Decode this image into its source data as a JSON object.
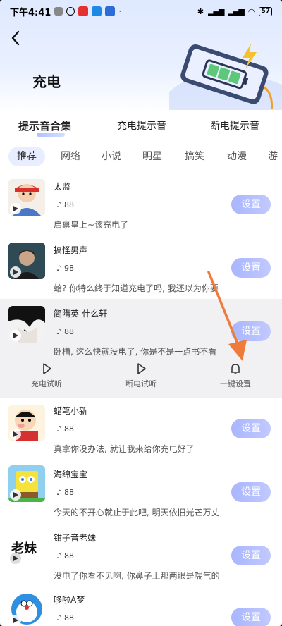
{
  "status_bar": {
    "time": "下午4:41",
    "battery": "57"
  },
  "header": {
    "title": "充电"
  },
  "main_tabs": [
    {
      "label": "提示音合集",
      "active": true
    },
    {
      "label": "充电提示音",
      "active": false
    },
    {
      "label": "断电提示音",
      "active": false
    }
  ],
  "categories": [
    "推荐",
    "网络",
    "小说",
    "明星",
    "搞笑",
    "动漫",
    "游"
  ],
  "items": [
    {
      "name": "太监",
      "plays": "88",
      "desc": "启禀皇上~该充电了",
      "button": "设置"
    },
    {
      "name": "搞怪男声",
      "plays": "98",
      "desc": "蛤? 你特么终于知道充电了吗, 我还以为你要",
      "button": "设置"
    },
    {
      "name": "简隋英-什么轩",
      "plays": "88",
      "desc": "卧槽, 这么快就没电了, 你是不是一点书不看",
      "button": "设置"
    },
    {
      "name": "蜡笔小新",
      "plays": "88",
      "desc": "真拿你没办法, 就让我来给你充电好了",
      "button": "设置"
    },
    {
      "name": "海绵宝宝",
      "plays": "88",
      "desc": "今天的不开心就止于此吧, 明天依旧光芒万丈",
      "button": "设置"
    },
    {
      "name": "钳子音老妹",
      "plays": "88",
      "desc": "没电了你看不见啊, 你鼻子上那两眼是喘气的",
      "button": "设置",
      "thumb_text": "老妹"
    },
    {
      "name": "哆啦A梦",
      "plays": "88",
      "desc": "",
      "button": "设置"
    }
  ],
  "actions": [
    {
      "label": "充电试听",
      "icon": "play-icon"
    },
    {
      "label": "断电试听",
      "icon": "play-icon"
    },
    {
      "label": "一键设置",
      "icon": "bell-icon"
    }
  ],
  "colors": {
    "accent": "#a9b6ff",
    "arrow": "#f07a3a",
    "header_bg": "#dfe9ff"
  }
}
